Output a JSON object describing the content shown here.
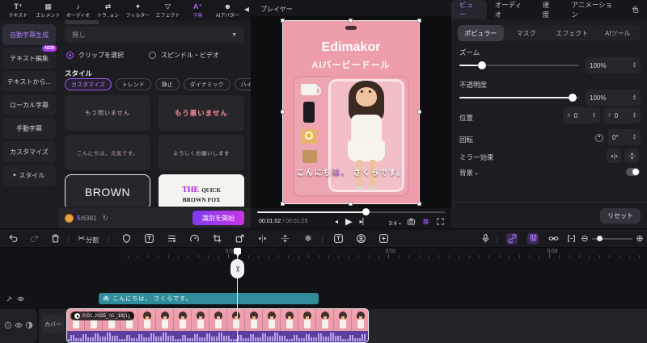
{
  "top_toolbar": {
    "items": [
      {
        "label": "テキスト"
      },
      {
        "label": "エレメント"
      },
      {
        "label": "オーディオ"
      },
      {
        "label": "トラ..ョン"
      },
      {
        "label": "フィルター"
      },
      {
        "label": "エフェクト"
      },
      {
        "label": "字幕"
      },
      {
        "label": "AIアバター"
      }
    ]
  },
  "sidebar": {
    "items": [
      {
        "label": "自動字幕生成"
      },
      {
        "label": "テキスト編集",
        "badge": "NEW"
      },
      {
        "label": "テキストから..."
      },
      {
        "label": "ローカル字幕"
      },
      {
        "label": "手動字幕"
      },
      {
        "label": "カスタマイズ"
      },
      {
        "label": "スタイル"
      }
    ]
  },
  "subtitle_panel": {
    "dropdown_value": "無し",
    "radio1": "クリップを選択",
    "radio2": "スピンドル・ビデオ",
    "style_label": "スタイル",
    "chips": [
      {
        "label": "カスタマイズ"
      },
      {
        "label": "トレンド"
      },
      {
        "label": "静止"
      },
      {
        "label": "ダイナミック"
      },
      {
        "label": "ハイライト"
      }
    ],
    "cards": [
      {
        "text": "もう問いません"
      },
      {
        "text": "もう悪いません"
      },
      {
        "text": "こんにちは、元気です。"
      },
      {
        "text": "よろしくお願いします"
      },
      {
        "text": "BROWN"
      },
      {
        "text_a": "THE",
        "text_b": "QUICK",
        "text_c": "BROWN FOX"
      }
    ],
    "credits_used": "5",
    "credits_total": "/6381",
    "start_button": "識別を開始"
  },
  "player": {
    "title": "プレイヤー",
    "pack_title": "Edimakor",
    "pack_subtitle": "AIバービードール",
    "cc_pre": "こんにち",
    "cc_hl": "は、",
    "cc_post": " さくらです。",
    "time_current": "00:01:02",
    "time_sep": " / ",
    "time_total": "00:01:25",
    "ratio": "3:4"
  },
  "view_panel": {
    "tabs": [
      {
        "label": "ビュー"
      },
      {
        "label": "オーディオ"
      },
      {
        "label": "速度"
      },
      {
        "label": "アニメーション"
      },
      {
        "label": "色"
      }
    ],
    "subtabs": [
      {
        "label": "ポピュラー"
      },
      {
        "label": "マスク"
      },
      {
        "label": "エフェクト"
      },
      {
        "label": "AIツール"
      }
    ],
    "zoom_label": "ズーム",
    "zoom_value": "100%",
    "opacity_label": "不透明度",
    "opacity_value": "100%",
    "position_label": "位置",
    "x_label": "X",
    "x_value": "0",
    "y_label": "Y",
    "y_value": "0",
    "rotation_label": "回転",
    "rotation_value": "0°",
    "mirror_label": "ミラー効果",
    "background_label": "背景",
    "reset_button": "リセット"
  },
  "edit_toolbar": {
    "split_label": "分割"
  },
  "timeline": {
    "ruler_labels": [
      {
        "label": "0:01"
      },
      {
        "label": "0:02"
      },
      {
        "label": "0:03"
      }
    ],
    "cover_label": "カバー",
    "subtitle_clip_badge": "A",
    "subtitle_clip_text": "こんにちは、 さくらです。",
    "video_clip_label": "0:01 2025_05_19(1)"
  }
}
